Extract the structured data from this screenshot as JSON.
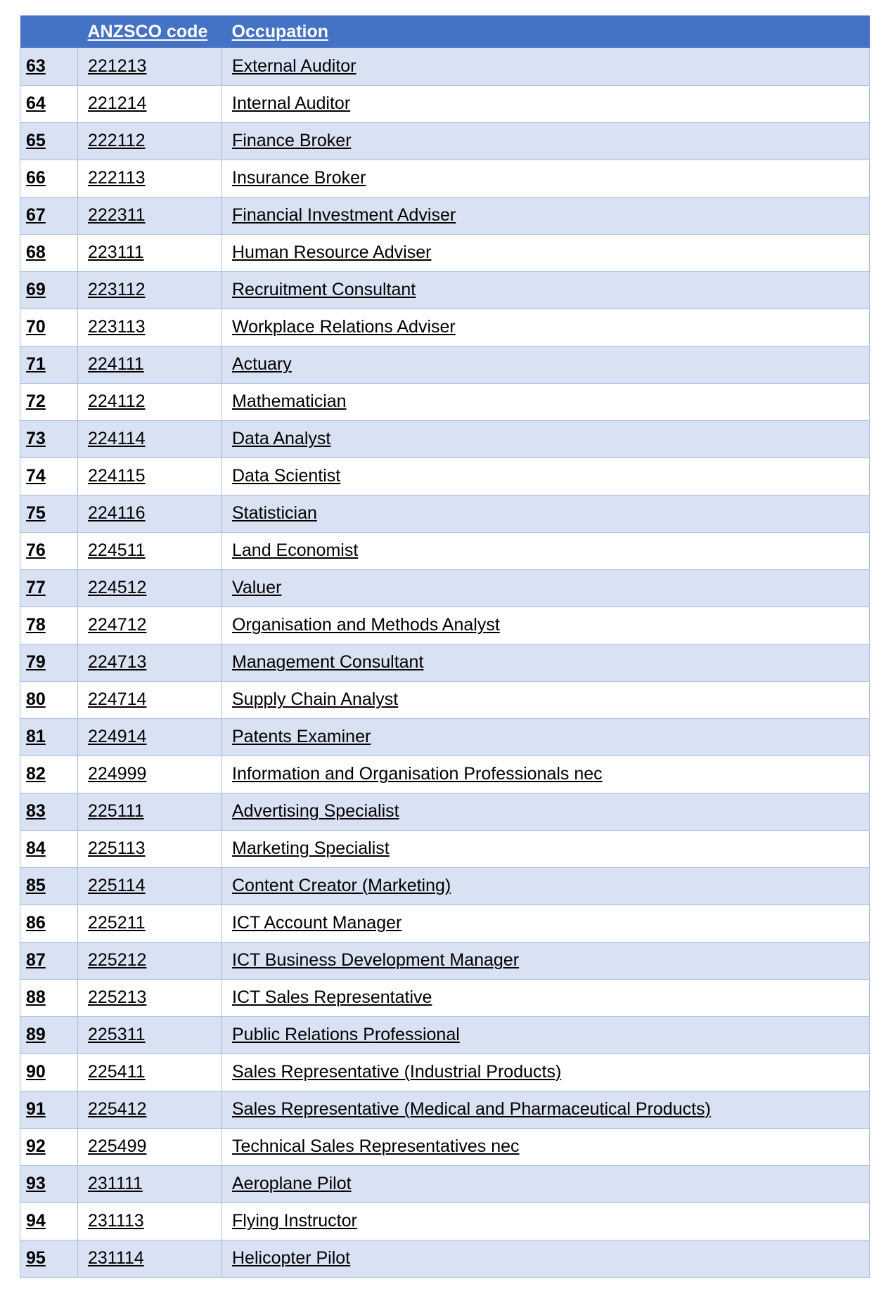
{
  "document": {
    "type": "occupation-list-table",
    "colors": {
      "header_background": "#4472C4",
      "header_text": "#FFFFFF",
      "row_shade": "#D9E2F3",
      "row_plain": "#FFFFFF",
      "border": "#A8BCE3",
      "body_text": "#000000"
    }
  },
  "table": {
    "headers": {
      "index": "",
      "code": "ANZSCO code",
      "occupation": "Occupation"
    },
    "rows": [
      {
        "index": "63",
        "code": "221213",
        "occupation": "External Auditor"
      },
      {
        "index": "64",
        "code": "221214",
        "occupation": "Internal Auditor"
      },
      {
        "index": "65",
        "code": "222112",
        "occupation": "Finance Broker"
      },
      {
        "index": "66",
        "code": "222113",
        "occupation": "Insurance Broker"
      },
      {
        "index": "67",
        "code": "222311",
        "occupation": "Financial Investment Adviser"
      },
      {
        "index": "68",
        "code": "223111",
        "occupation": "Human Resource Adviser"
      },
      {
        "index": "69",
        "code": "223112",
        "occupation": "Recruitment Consultant"
      },
      {
        "index": "70",
        "code": "223113",
        "occupation": "Workplace Relations Adviser"
      },
      {
        "index": "71",
        "code": "224111",
        "occupation": "Actuary"
      },
      {
        "index": "72",
        "code": "224112",
        "occupation": "Mathematician"
      },
      {
        "index": "73",
        "code": "224114",
        "occupation": "Data Analyst"
      },
      {
        "index": "74",
        "code": "224115",
        "occupation": "Data Scientist"
      },
      {
        "index": "75",
        "code": "224116",
        "occupation": "Statistician"
      },
      {
        "index": "76",
        "code": "224511",
        "occupation": "Land Economist"
      },
      {
        "index": "77",
        "code": "224512",
        "occupation": "Valuer"
      },
      {
        "index": "78",
        "code": "224712",
        "occupation": "Organisation and Methods Analyst"
      },
      {
        "index": "79",
        "code": "224713",
        "occupation": "Management Consultant"
      },
      {
        "index": "80",
        "code": "224714",
        "occupation": "Supply Chain Analyst"
      },
      {
        "index": "81",
        "code": "224914",
        "occupation": "Patents Examiner"
      },
      {
        "index": "82",
        "code": "224999",
        "occupation": "Information and Organisation Professionals nec"
      },
      {
        "index": "83",
        "code": "225111",
        "occupation": "Advertising Specialist"
      },
      {
        "index": "84",
        "code": "225113",
        "occupation": "Marketing Specialist"
      },
      {
        "index": "85",
        "code": "225114",
        "occupation": "Content Creator (Marketing)"
      },
      {
        "index": "86",
        "code": "225211",
        "occupation": "ICT Account Manager"
      },
      {
        "index": "87",
        "code": "225212",
        "occupation": "ICT Business Development Manager"
      },
      {
        "index": "88",
        "code": "225213",
        "occupation": "ICT Sales Representative"
      },
      {
        "index": "89",
        "code": "225311",
        "occupation": "Public Relations Professional"
      },
      {
        "index": "90",
        "code": "225411",
        "occupation": "Sales Representative (Industrial Products)"
      },
      {
        "index": "91",
        "code": "225412",
        "occupation": "Sales Representative (Medical and Pharmaceutical Products)"
      },
      {
        "index": "92",
        "code": "225499",
        "occupation": "Technical Sales Representatives nec"
      },
      {
        "index": "93",
        "code": "231111",
        "occupation": "Aeroplane Pilot"
      },
      {
        "index": "94",
        "code": "231113",
        "occupation": "Flying Instructor"
      },
      {
        "index": "95",
        "code": "231114",
        "occupation": "Helicopter Pilot"
      }
    ]
  }
}
